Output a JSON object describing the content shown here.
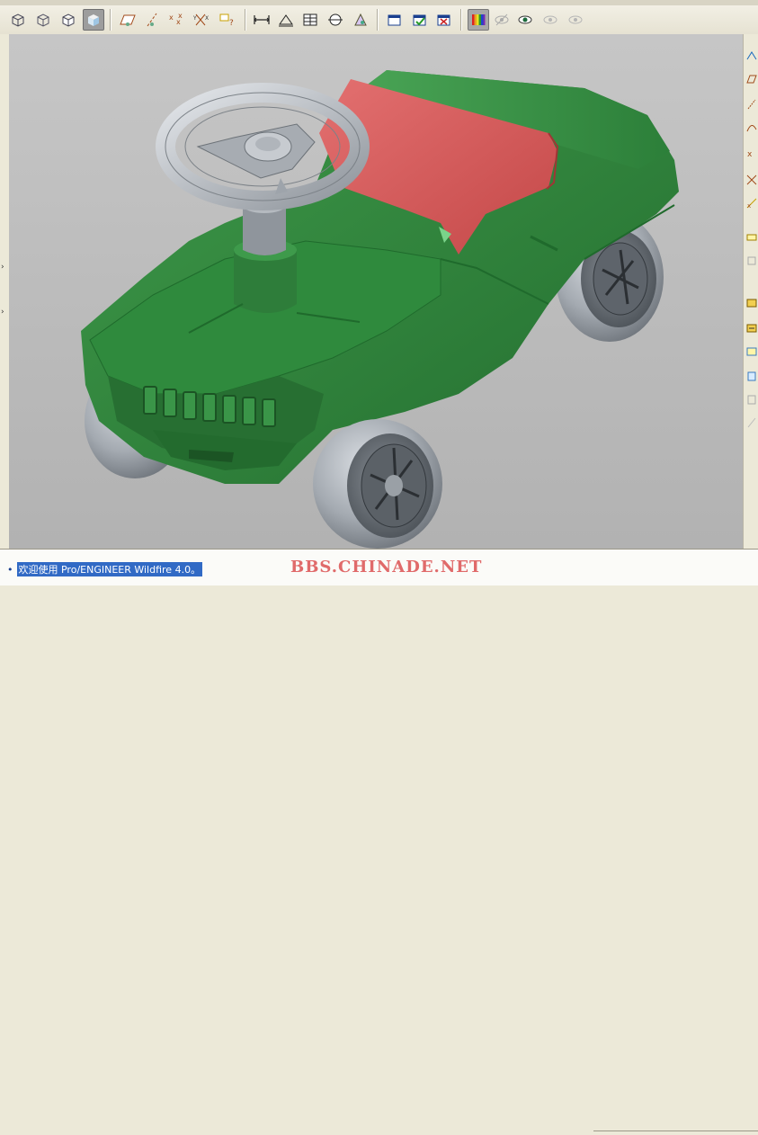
{
  "toolbar": {
    "view_buttons": [
      {
        "name": "wireframe-view-icon"
      },
      {
        "name": "hidden-line-view-icon"
      },
      {
        "name": "no-hidden-view-icon"
      },
      {
        "name": "shaded-view-icon",
        "active": true
      }
    ],
    "datum_buttons": [
      {
        "name": "datum-planes-icon"
      },
      {
        "name": "datum-axes-icon"
      },
      {
        "name": "datum-points-icon"
      },
      {
        "name": "coordinate-systems-icon"
      },
      {
        "name": "annotations-icon"
      }
    ],
    "tool_buttons": [
      {
        "name": "measure-icon"
      },
      {
        "name": "analysis-icon"
      },
      {
        "name": "table-icon"
      },
      {
        "name": "section-icon"
      },
      {
        "name": "mass-properties-icon"
      }
    ],
    "window_buttons": [
      {
        "name": "new-window-icon"
      },
      {
        "name": "activate-window-icon"
      },
      {
        "name": "close-window-icon"
      }
    ],
    "appearance_buttons": [
      {
        "name": "color-appearance-icon",
        "active": true
      },
      {
        "name": "hide-icon"
      },
      {
        "name": "show-icon"
      },
      {
        "name": "hide-layer-icon"
      },
      {
        "name": "show-layer-icon"
      }
    ]
  },
  "right_toolbar": {
    "buttons": [
      {
        "name": "sketch-icon"
      },
      {
        "name": "plane-icon"
      },
      {
        "name": "axis-icon"
      },
      {
        "name": "curve-icon"
      },
      {
        "name": "point-icon"
      },
      {
        "name": "csys-icon"
      },
      {
        "name": "offset-csys-icon"
      },
      {
        "name": "analysis-feature-icon"
      },
      {
        "name": "pattern-icon"
      },
      {
        "name": "extrude-icon"
      },
      {
        "name": "revolve-icon"
      },
      {
        "name": "sweep-icon"
      },
      {
        "name": "blend-icon"
      },
      {
        "name": "hole-icon"
      },
      {
        "name": "round-icon"
      }
    ]
  },
  "status": {
    "message": "欢迎使用 Pro/ENGINEER Wildfire 4.0。"
  },
  "watermark": "BBS.CHINADE.NET",
  "colors": {
    "body_green": "#2e8a3d",
    "seat_red": "#d95959",
    "wheel_gray": "#9ea4ab",
    "viewport_bg": "#bdbdbd"
  }
}
